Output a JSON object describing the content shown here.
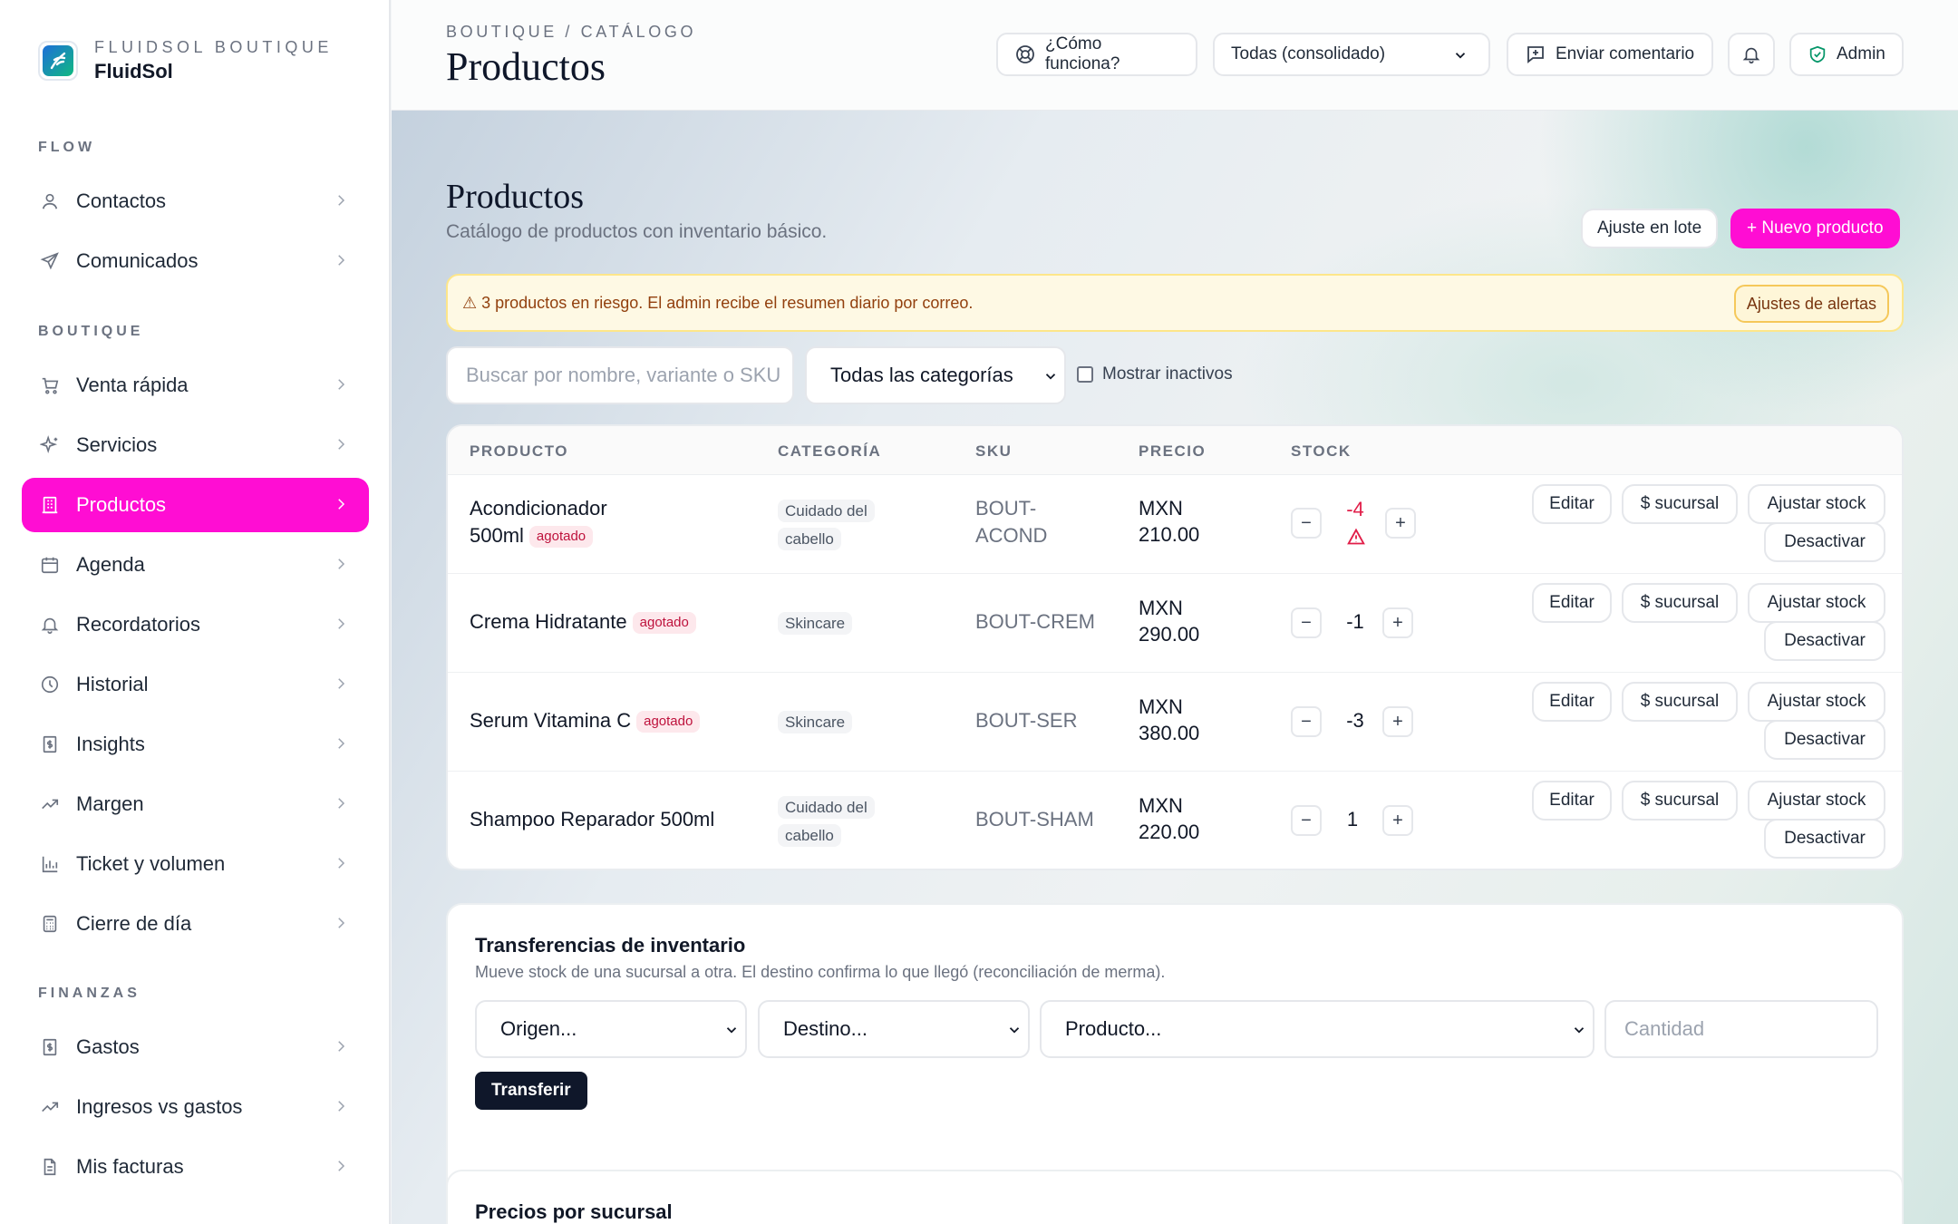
{
  "brand": {
    "kicker": "FLUIDSOL BOUTIQUE",
    "name": "FluidSol"
  },
  "sidebar": {
    "sections": {
      "flow": "FLOW",
      "boutique": "BOUTIQUE",
      "finanzas": "FINANZAS"
    },
    "items": [
      {
        "label": "Contactos",
        "icon": "user-icon"
      },
      {
        "label": "Comunicados",
        "icon": "send-icon"
      },
      {
        "label": "Venta rápida",
        "icon": "cart-icon"
      },
      {
        "label": "Servicios",
        "icon": "sparkles-icon"
      },
      {
        "label": "Productos",
        "icon": "building-icon",
        "active": true
      },
      {
        "label": "Agenda",
        "icon": "calendar-icon"
      },
      {
        "label": "Recordatorios",
        "icon": "bell-icon"
      },
      {
        "label": "Historial",
        "icon": "clock-icon"
      },
      {
        "label": "Insights",
        "icon": "receipt-icon"
      },
      {
        "label": "Margen",
        "icon": "trending-up-icon"
      },
      {
        "label": "Ticket y volumen",
        "icon": "bar-chart-icon"
      },
      {
        "label": "Cierre de día",
        "icon": "calculator-icon"
      },
      {
        "label": "Gastos",
        "icon": "receipt-icon"
      },
      {
        "label": "Ingresos vs gastos",
        "icon": "trending-up-icon"
      },
      {
        "label": "Mis facturas",
        "icon": "file-icon"
      }
    ]
  },
  "header": {
    "breadcrumb": "BOUTIQUE / CATÁLOGO",
    "title": "Productos",
    "help_label": "¿Cómo funciona?",
    "branch_select": "Todas (consolidado)",
    "feedback_label": "Enviar comentario",
    "admin_label": "Admin"
  },
  "main": {
    "title": "Productos",
    "subtitle": "Catálogo de productos con inventario básico.",
    "batch_label": "Ajuste en lote",
    "new_label": "+ Nuevo producto",
    "alert_text": "⚠ 3 productos en riesgo. El admin recibe el resumen diario por correo.",
    "alert_button": "Ajustes de alertas",
    "search_placeholder": "Buscar por nombre, variante o SKU",
    "category_select": "Todas las categorías",
    "show_inactive": "Mostrar inactivos"
  },
  "table": {
    "columns": [
      "PRODUCTO",
      "CATEGORÍA",
      "SKU",
      "PRECIO",
      "STOCK"
    ],
    "actions": {
      "edit": "Editar",
      "branch": "$ sucursal",
      "adjust": "Ajustar stock",
      "deactivate": "Desactivar"
    },
    "rows": [
      {
        "name1": "Acondicionador",
        "name2": "500ml",
        "badge": "agotado",
        "cat1": "Cuidado del",
        "cat2": "cabello",
        "sku1": "BOUT-",
        "sku2": "ACOND",
        "price1": "MXN",
        "price2": "210.00",
        "stock": "-4",
        "warning": true
      },
      {
        "name1": "Crema Hidratante",
        "name2": "",
        "badge": "agotado",
        "cat1": "Skincare",
        "cat2": "",
        "sku1": "BOUT-CREM",
        "sku2": "",
        "price1": "MXN",
        "price2": "290.00",
        "stock": "-1",
        "warning": false
      },
      {
        "name1": "Serum Vitamina C",
        "name2": "",
        "badge": "agotado",
        "cat1": "Skincare",
        "cat2": "",
        "sku1": "BOUT-SER",
        "sku2": "",
        "price1": "MXN",
        "price2": "380.00",
        "stock": "-3",
        "warning": false
      },
      {
        "name1": "Shampoo Reparador 500ml",
        "name2": "",
        "badge": "",
        "cat1": "Cuidado del",
        "cat2": "cabello",
        "sku1": "BOUT-SHAM",
        "sku2": "",
        "price1": "MXN",
        "price2": "220.00",
        "stock": "1",
        "warning": false
      }
    ],
    "minus": "−",
    "plus": "+"
  },
  "transfers": {
    "title": "Transferencias de inventario",
    "subtitle": "Mueve stock de una sucursal a otra. El destino confirma lo que llegó (reconciliación de merma).",
    "origin": "Origen...",
    "destination": "Destino...",
    "product": "Producto...",
    "quantity_placeholder": "Cantidad",
    "button": "Transferir"
  },
  "branch_prices": {
    "title": "Precios por sucursal"
  },
  "colors": {
    "accent": "#ff0dd3",
    "danger": "#e11d48",
    "dark": "#0f172a"
  }
}
